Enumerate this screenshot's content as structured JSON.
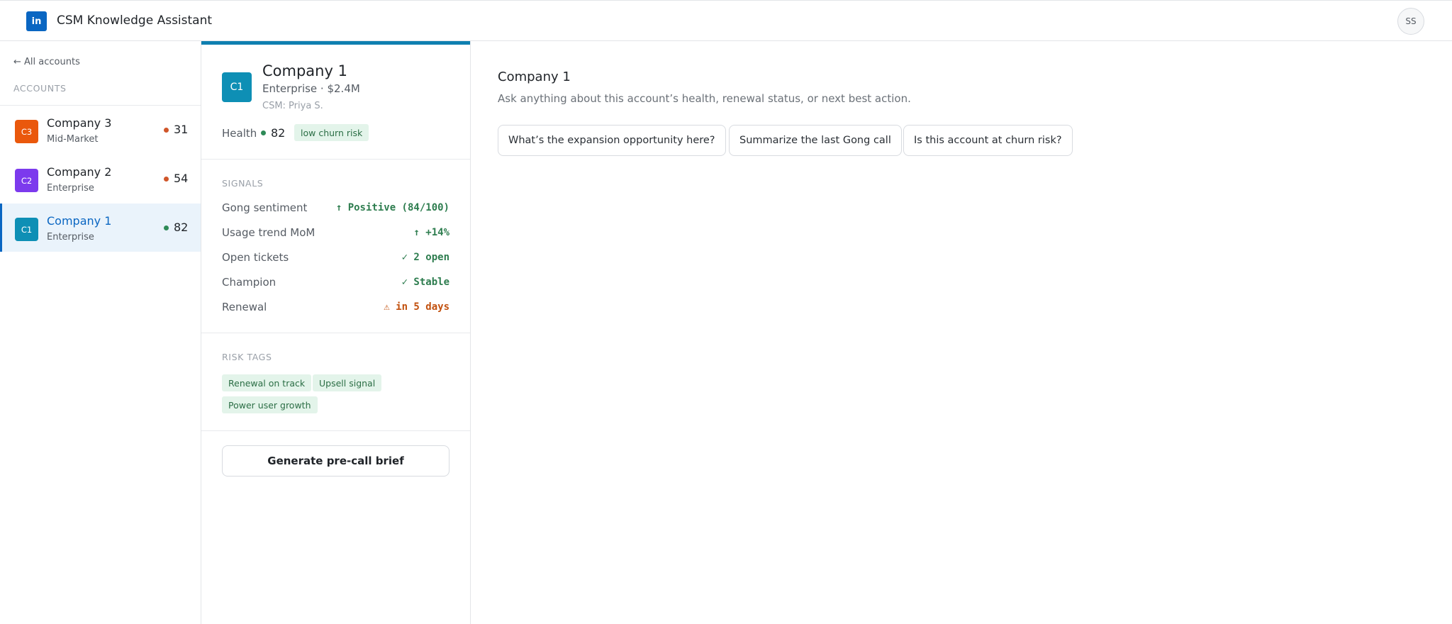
{
  "app": {
    "logo_text": "in",
    "title": "CSM Knowledge Assistant",
    "user_initials": "SS"
  },
  "sidebar": {
    "back_label": "← All accounts",
    "section_label": "ACCOUNTS",
    "accounts": [
      {
        "badge": "C3",
        "name": "Company 3",
        "segment": "Mid-Market",
        "score": "31",
        "badge_color": "#ea580c",
        "dot_color": "#d0562a"
      },
      {
        "badge": "C2",
        "name": "Company 2",
        "segment": "Enterprise",
        "score": "54",
        "badge_color": "#7c3aed",
        "dot_color": "#d0562a"
      },
      {
        "badge": "C1",
        "name": "Company 1",
        "segment": "Enterprise",
        "score": "82",
        "badge_color": "#0e8fb5",
        "dot_color": "#2e8a57"
      }
    ]
  },
  "detail": {
    "badge": "C1",
    "name": "Company 1",
    "segment_arr": "Enterprise · $2.4M",
    "csm": "CSM: Priya S.",
    "health_label": "Health",
    "health_score": "82",
    "churn_pill": "low churn risk",
    "signals_label": "SIGNALS",
    "signals": [
      {
        "label": "Gong sentiment",
        "value": "↑ Positive (84/100)",
        "color": "#2e7d4f"
      },
      {
        "label": "Usage trend MoM",
        "value": "↑ +14%",
        "color": "#2e7d4f"
      },
      {
        "label": "Open tickets",
        "value": "✓ 2 open",
        "color": "#2e7d4f"
      },
      {
        "label": "Champion",
        "value": "✓ Stable",
        "color": "#2e7d4f"
      },
      {
        "label": "Renewal",
        "value": "⚠ in 5 days",
        "color": "#c2510f"
      }
    ],
    "risk_tags_label": "RISK TAGS",
    "risk_tags": [
      "Renewal on track",
      "Upsell signal",
      "Power user growth"
    ],
    "brief_button": "Generate pre-call brief"
  },
  "chat": {
    "title": "Company 1",
    "subtitle": "Ask anything about this account’s health, renewal status, or next best action.",
    "suggestions": [
      "What’s the expansion opportunity here?",
      "Summarize the last Gong call",
      "Is this account at churn risk?"
    ]
  }
}
